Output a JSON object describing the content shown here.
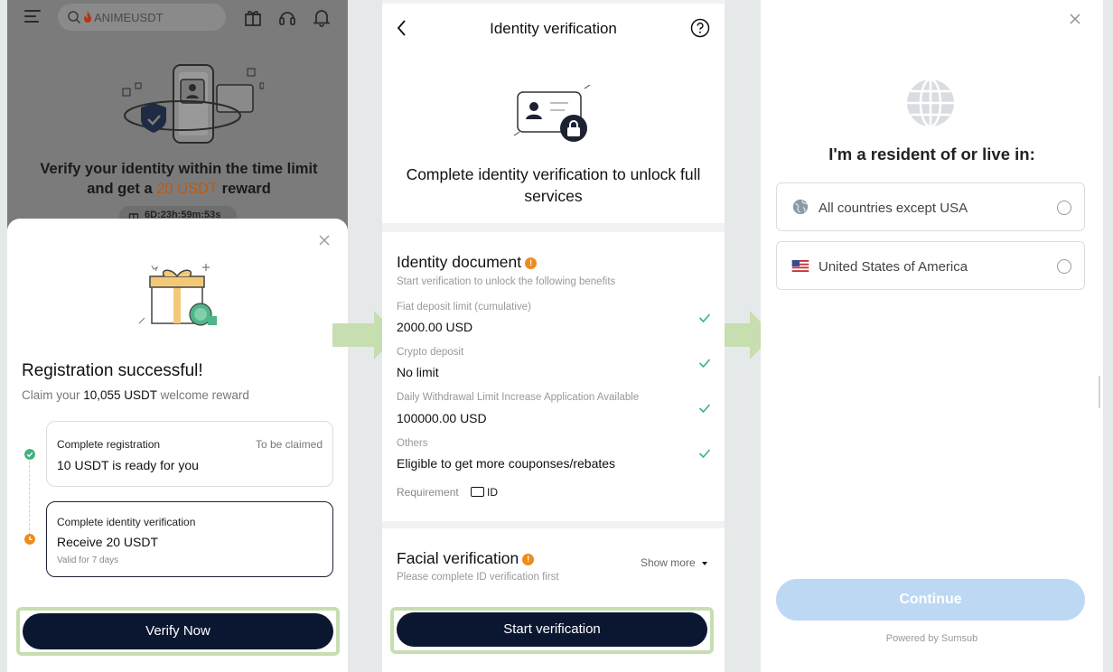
{
  "colors": {
    "accent_dark": "#0b1730",
    "highlight_green": "#c7deb0",
    "reward_orange": "#c2590d",
    "check_green": "#38b57a",
    "continue_disabled": "#bdd8f3"
  },
  "panel1": {
    "search_text": "ANIMEUSDT",
    "headline_pre": "Verify your identity within the time limit and get a ",
    "headline_reward": "20 USDT",
    "headline_post": " reward",
    "timer": "6D:23h:59m:53s",
    "modal_title": "Registration successful!",
    "modal_sub_pre": "Claim your ",
    "modal_sub_amount": "10,055 USDT",
    "modal_sub_post": " welcome reward",
    "steps": [
      {
        "title": "Complete registration",
        "status": "To be claimed",
        "value": "10 USDT is ready for you",
        "state": "done"
      },
      {
        "title": "Complete identity verification",
        "value": "Receive 20 USDT",
        "note": "Valid for 7 days",
        "state": "pending"
      }
    ],
    "cta": "Verify Now",
    "icons": [
      "menu-icon",
      "search-icon",
      "fire-icon",
      "gift-icon",
      "headset-icon",
      "bell-icon",
      "close-icon",
      "check-circle-icon",
      "clock-icon"
    ]
  },
  "panel2": {
    "title": "Identity verification",
    "intro": "Complete identity verification to unlock full services",
    "doc_title": "Identity document",
    "doc_sub": "Start verification to unlock the following benefits",
    "benefits": [
      {
        "label": "Fiat deposit limit (cumulative)",
        "value": "2000.00 USD"
      },
      {
        "label": "Crypto deposit",
        "value": "No limit"
      },
      {
        "label": "Daily Withdrawal Limit Increase Application Available",
        "value": "100000.00 USD"
      },
      {
        "label": "Others",
        "value": "Eligible to get more couponses/rebates"
      }
    ],
    "requirement_label": "Requirement",
    "requirement_value": "ID",
    "facial_title": "Facial verification",
    "facial_sub": "Please complete ID verification first",
    "show_more": "Show more",
    "cta": "Start verification",
    "icons": [
      "back-icon",
      "help-icon",
      "lock-icon",
      "check-icon",
      "id-card-icon",
      "caret-down-icon"
    ]
  },
  "panel3": {
    "title": "I'm a resident of or live in:",
    "options": [
      {
        "label": "All countries except USA",
        "icon": "globe-icon",
        "selected": false
      },
      {
        "label": "United States of America",
        "icon": "us-flag-icon",
        "selected": false
      }
    ],
    "cta": "Continue",
    "powered_by": "Powered by Sumsub",
    "icons": [
      "close-icon",
      "globe-icon"
    ]
  }
}
